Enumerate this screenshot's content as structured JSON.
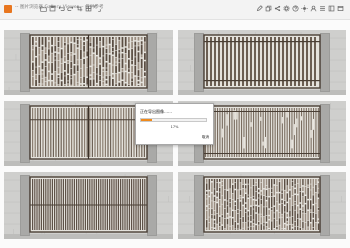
{
  "window": {
    "title": "-- 图片浏览器 Gallery Viewer -- 仅供参考",
    "accent_color": "#e8761f"
  },
  "toolbar": {
    "left_icons": [
      "folder-icon",
      "save-icon",
      "undo-icon",
      "redo-icon",
      "crop-icon",
      "grid-icon",
      "expand-icon"
    ],
    "right_icons": [
      "edit-icon",
      "copy-icon",
      "share-icon",
      "settings-icon",
      "help-icon",
      "sun-icon",
      "user-icon",
      "menu-icon",
      "layout-icon",
      "window-icon"
    ]
  },
  "gallery": {
    "thumbnails": [
      {
        "name": "gate-thumbnail-1",
        "style": "patterned",
        "row": 1,
        "col": 1
      },
      {
        "name": "gate-thumbnail-2",
        "style": "vertical-slats",
        "row": 1,
        "col": 2
      },
      {
        "name": "gate-thumbnail-3",
        "style": "slats-two-panel",
        "row": 2,
        "col": 1
      },
      {
        "name": "gate-thumbnail-4",
        "style": "dense-slats",
        "row": 2,
        "col": 2
      },
      {
        "name": "gate-thumbnail-5",
        "style": "vertical-bars",
        "row": 3,
        "col": 1
      },
      {
        "name": "gate-thumbnail-6",
        "style": "patterned-slats",
        "row": 3,
        "col": 2
      }
    ]
  },
  "dialog": {
    "title": "正在导出图像……",
    "progress_percent": 17,
    "progress_label": "17%",
    "cancel_label": "取消",
    "progress_color": "#ef8a1c"
  }
}
